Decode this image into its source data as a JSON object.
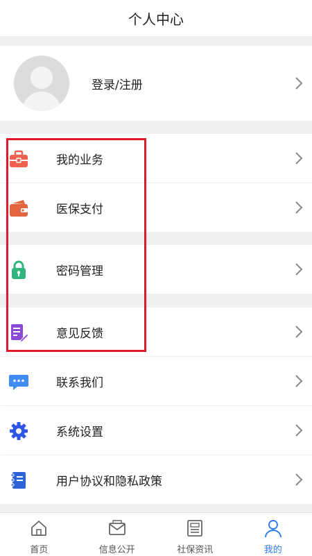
{
  "header": {
    "title": "个人中心"
  },
  "profile": {
    "login_label": "登录/注册"
  },
  "menu": {
    "my_business": "我的业务",
    "medical_pay": "医保支付",
    "password": "密码管理",
    "feedback": "意见反馈",
    "contact": "联系我们",
    "settings": "系统设置",
    "privacy": "用户协议和隐私政策"
  },
  "tabbar": {
    "home": "首页",
    "info": "信息公开",
    "news": "社保资讯",
    "mine": "我的",
    "active": "我的"
  },
  "colors": {
    "accent": "#2d7bf2",
    "highlight": "#e0182a",
    "business_icon": "#f0614f",
    "wallet_icon": "#e3653e",
    "lock_icon": "#2fb67c",
    "feedback_icon": "#8b49d8",
    "contact_icon": "#3f8cf2",
    "settings_icon": "#2f56e6",
    "privacy_icon": "#2f63d8"
  },
  "icons": {
    "my_business": "briefcase-icon",
    "medical_pay": "wallet-icon",
    "password": "lock-icon",
    "feedback": "edit-document-icon",
    "contact": "chat-bubble-icon",
    "settings": "gear-icon",
    "privacy": "book-icon"
  }
}
